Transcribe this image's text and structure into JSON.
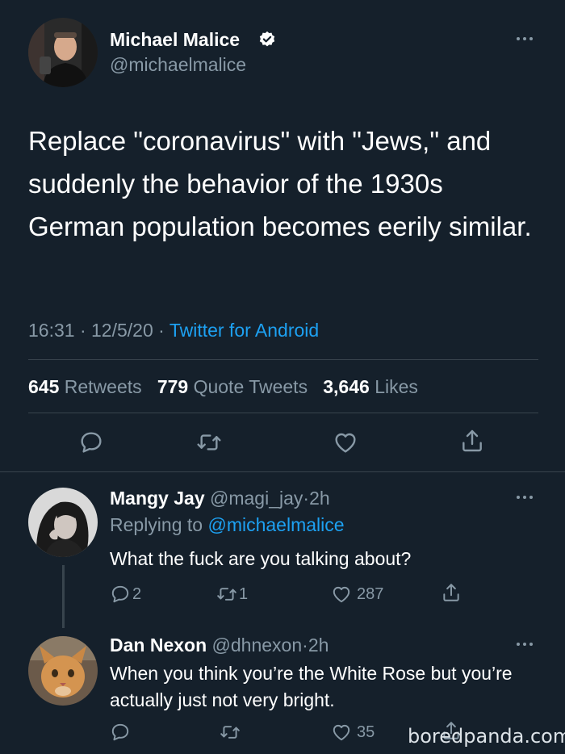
{
  "main_tweet": {
    "author_name": "Michael Malice",
    "author_handle": "@michaelmalice",
    "text": "Replace \"coronavirus\" with \"Jews,\" and suddenly the behavior of the 1930s German population becomes eerily similar.",
    "time": "16:31",
    "date": "12/5/20",
    "source": "Twitter for Android",
    "sep": "·",
    "stats": {
      "retweets_count": "645",
      "retweets_label": "Retweets",
      "quotes_count": "779",
      "quotes_label": "Quote Tweets",
      "likes_count": "3,646",
      "likes_label": "Likes"
    }
  },
  "replies": [
    {
      "author_name": "Mangy Jay",
      "author_handle": "@magi_jay",
      "time": "2h",
      "replying_prefix": "Replying to",
      "replying_handle": "@michaelmalice",
      "text": "What the fuck are you talking about?",
      "reply_count": "2",
      "retweet_count": "1",
      "like_count": "287"
    },
    {
      "author_name": "Dan Nexon",
      "author_handle": "@dhnexon",
      "time": "2h",
      "text": "When you think you’re the White Rose but you’re actually just not very bright.",
      "like_count": "35"
    }
  ],
  "watermark": "boredpanda.com",
  "colors": {
    "background": "#15202b",
    "text": "#ffffff",
    "muted": "#8899a6",
    "accent": "#1da1f2",
    "divider": "#38444d"
  },
  "icons": [
    "verified-badge-icon",
    "more-icon",
    "reply-icon",
    "retweet-icon",
    "like-icon",
    "share-icon"
  ]
}
